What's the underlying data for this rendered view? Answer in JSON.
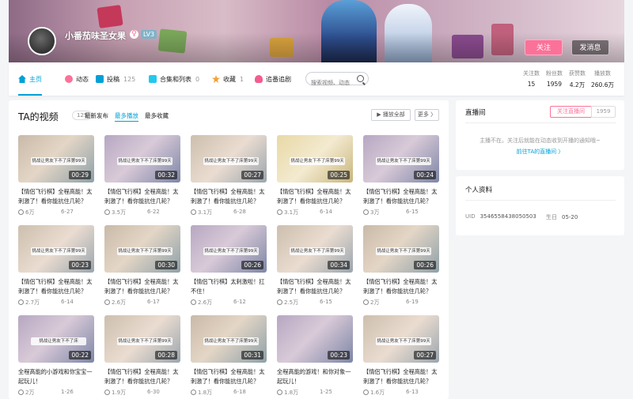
{
  "header": {
    "username": "小番茄味圣女果",
    "gender_symbol": "♀",
    "level": "LV3",
    "follow_label": "关注",
    "message_label": "发消息"
  },
  "nav": {
    "items": [
      {
        "label": "主页",
        "count": "",
        "icon": "home-icon",
        "color": "#00a1d6"
      },
      {
        "label": "动态",
        "count": "",
        "icon": "activity-icon",
        "color": "#fb7299"
      },
      {
        "label": "投稿",
        "count": "125",
        "icon": "upload-icon",
        "color": "#00a1d6"
      },
      {
        "label": "合集和列表",
        "count": "0",
        "icon": "collection-icon",
        "color": "#23c9ed"
      },
      {
        "label": "收藏",
        "count": "1",
        "icon": "favorite-icon",
        "color": "#f3a034"
      },
      {
        "label": "追番追剧",
        "count": "",
        "icon": "bangumi-icon",
        "color": "#f25d8e"
      }
    ],
    "search_placeholder": "搜索视频、动态"
  },
  "stats": [
    {
      "label": "关注数",
      "value": "15"
    },
    {
      "label": "粉丝数",
      "value": "1959"
    },
    {
      "label": "获赞数",
      "value": "4.2万"
    },
    {
      "label": "播放数",
      "value": "260.6万"
    }
  ],
  "videos_section": {
    "title": "TA的视频",
    "count": "125",
    "sort_options": [
      "最新发布",
      "最多播放",
      "最多收藏"
    ],
    "active_sort": "最多播放",
    "play_all": "▶ 播放全部",
    "more": "更多 〉",
    "videos": [
      {
        "duration": "00:29",
        "title": "【情侣飞行棋】全程高能！太刺激了！看你能抗住几轮？",
        "plays": "6万",
        "date": "6-27",
        "caption": "挑战让男友下不了床第99天"
      },
      {
        "duration": "00:32",
        "title": "【情侣飞行棋】全程高能！太刺激了！看你能抗住几轮？",
        "plays": "3.5万",
        "date": "6-22",
        "caption": "挑战让男友下不了床第99天"
      },
      {
        "duration": "00:27",
        "title": "【情侣飞行棋】全程高能！太刺激了！看你能抗住几轮？",
        "plays": "3.1万",
        "date": "6-28",
        "caption": "挑战让男友下不了床第99天"
      },
      {
        "duration": "00:25",
        "title": "【情侣飞行棋】全程高能！太刺激了！看你能抗住几轮？",
        "plays": "3.1万",
        "date": "6-14",
        "caption": "挑战让男友下不了床第99天"
      },
      {
        "duration": "00:24",
        "title": "【情侣飞行棋】全程高能！太刺激了！看你能抗住几轮？",
        "plays": "3万",
        "date": "6-15",
        "caption": "挑战让男友下不了床第99天"
      },
      {
        "duration": "00:23",
        "title": "【情侣飞行棋】全程高能！太刺激了！看你能抗住几轮？",
        "plays": "2.7万",
        "date": "6-14",
        "caption": "挑战让男友下不了床第99天"
      },
      {
        "duration": "00:30",
        "title": "【情侣飞行棋】全程高能！太刺激了！看你能抗住几轮？",
        "plays": "2.6万",
        "date": "6-17",
        "caption": "挑战让男友下不了床第99天"
      },
      {
        "duration": "00:26",
        "title": "【情侣飞行棋】太刺激啦！扛不住！",
        "plays": "2.6万",
        "date": "6-12",
        "caption": "挑战让男友下不了床第99天"
      },
      {
        "duration": "00:34",
        "title": "【情侣飞行棋】全程高能！太刺激了！看你能抗住几轮？",
        "plays": "2.5万",
        "date": "6-15",
        "caption": "挑战让男友下不了床第99天"
      },
      {
        "duration": "00:26",
        "title": "【情侣飞行棋】全程高能！太刺激了！看你能抗住几轮？",
        "plays": "2万",
        "date": "6-19",
        "caption": "挑战让男友下不了床第99天"
      },
      {
        "duration": "00:22",
        "title": "全程高能的小游戏和你宝宝一起玩儿！",
        "plays": "2万",
        "date": "1-26",
        "caption": "挑战让男友下不了床"
      },
      {
        "duration": "00:28",
        "title": "【情侣飞行棋】全程高能！太刺激了！看你能抗住几轮？",
        "plays": "1.9万",
        "date": "6-30",
        "caption": "挑战让男友下不了床第99天"
      },
      {
        "duration": "00:31",
        "title": "【情侣飞行棋】全程高能！太刺激了！看你能抗住几轮？",
        "plays": "1.8万",
        "date": "6-18",
        "caption": "挑战让男友下不了床第99天"
      },
      {
        "duration": "00:23",
        "title": "全程高能的游戏！和你对象一起玩儿！",
        "plays": "1.8万",
        "date": "1-25",
        "caption": ""
      },
      {
        "duration": "00:27",
        "title": "【情侣飞行棋】全程高能！太刺激了！看你能抗住几轮？",
        "plays": "1.6万",
        "date": "6-13",
        "caption": "挑战让男友下不了床第99天"
      }
    ]
  },
  "live": {
    "title": "直播间",
    "subscribe_label": "关注直播间",
    "subscribe_count": "1959",
    "message": "主播不在。关注后就能在动态收到开播的通知哦~",
    "link": "前往TA的直播间 〉"
  },
  "profile": {
    "title": "个人资料",
    "uid_label": "UID",
    "uid": "3546558438050503",
    "birthday_label": "生日",
    "birthday": "05-20"
  },
  "colors": {
    "accent": "#00a1d6",
    "pink": "#fb7299"
  }
}
